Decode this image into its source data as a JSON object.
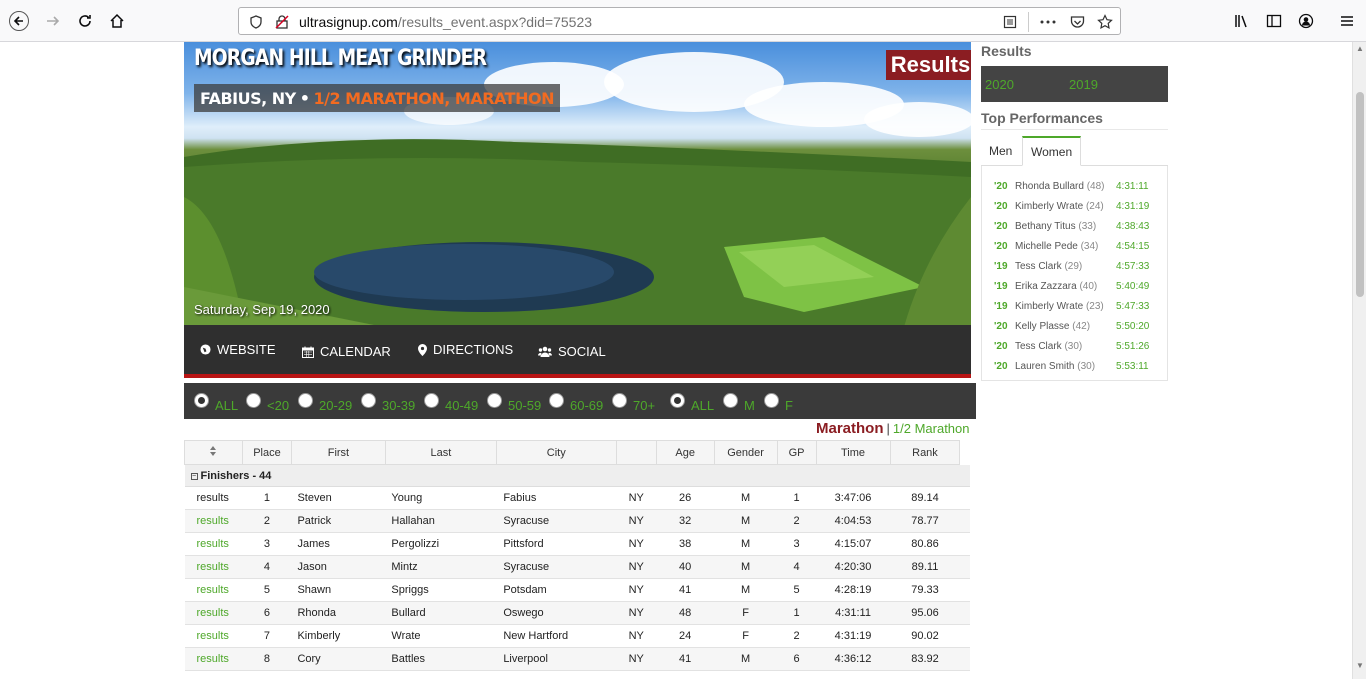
{
  "browser": {
    "url_domain": "ultrasignup.com",
    "url_path": "/results_event.aspx?did=75523"
  },
  "hero": {
    "title": "MORGAN HILL MEAT GRINDER",
    "location": "FABIUS, NY",
    "separator": "•",
    "distances": "1/2 MARATHON, MARATHON",
    "badge": "Results",
    "date": "Saturday, Sep 19, 2020"
  },
  "nav": {
    "website": "WEBSITE",
    "calendar": "CALENDAR",
    "directions": "DIRECTIONS",
    "social": "SOCIAL"
  },
  "filters": {
    "age": [
      {
        "label": "ALL",
        "selected": true
      },
      {
        "label": "<20",
        "selected": false
      },
      {
        "label": "20-29",
        "selected": false
      },
      {
        "label": "30-39",
        "selected": false
      },
      {
        "label": "40-49",
        "selected": false
      },
      {
        "label": "50-59",
        "selected": false
      },
      {
        "label": "60-69",
        "selected": false
      },
      {
        "label": "70+",
        "selected": false
      }
    ],
    "gender": [
      {
        "label": "ALL",
        "selected": true
      },
      {
        "label": "M",
        "selected": false
      },
      {
        "label": "F",
        "selected": false
      }
    ]
  },
  "distance_tabs": {
    "active": "Marathon",
    "separator": "|",
    "other": "1/2 Marathon"
  },
  "table": {
    "sort_icon": "sort-arrows-icon",
    "headers": [
      "Place",
      "First",
      "Last",
      "City",
      "",
      "Age",
      "Gender",
      "GP",
      "Time",
      "Rank"
    ],
    "group_label": "Finishers - 44",
    "rows": [
      {
        "link": "results",
        "place": "1",
        "first": "Steven",
        "last": "Young",
        "city": "Fabius",
        "state": "NY",
        "age": "26",
        "gender": "M",
        "gp": "1",
        "time": "3:47:06",
        "rank": "89.14"
      },
      {
        "link": "results",
        "place": "2",
        "first": "Patrick",
        "last": "Hallahan",
        "city": "Syracuse",
        "state": "NY",
        "age": "32",
        "gender": "M",
        "gp": "2",
        "time": "4:04:53",
        "rank": "78.77"
      },
      {
        "link": "results",
        "place": "3",
        "first": "James",
        "last": "Pergolizzi",
        "city": "Pittsford",
        "state": "NY",
        "age": "38",
        "gender": "M",
        "gp": "3",
        "time": "4:15:07",
        "rank": "80.86"
      },
      {
        "link": "results",
        "place": "4",
        "first": "Jason",
        "last": "Mintz",
        "city": "Syracuse",
        "state": "NY",
        "age": "40",
        "gender": "M",
        "gp": "4",
        "time": "4:20:30",
        "rank": "89.11"
      },
      {
        "link": "results",
        "place": "5",
        "first": "Shawn",
        "last": "Spriggs",
        "city": "Potsdam",
        "state": "NY",
        "age": "41",
        "gender": "M",
        "gp": "5",
        "time": "4:28:19",
        "rank": "79.33"
      },
      {
        "link": "results",
        "place": "6",
        "first": "Rhonda",
        "last": "Bullard",
        "city": "Oswego",
        "state": "NY",
        "age": "48",
        "gender": "F",
        "gp": "1",
        "time": "4:31:11",
        "rank": "95.06"
      },
      {
        "link": "results",
        "place": "7",
        "first": "Kimberly",
        "last": "Wrate",
        "city": "New Hartford",
        "state": "NY",
        "age": "24",
        "gender": "F",
        "gp": "2",
        "time": "4:31:19",
        "rank": "90.02"
      },
      {
        "link": "results",
        "place": "8",
        "first": "Cory",
        "last": "Battles",
        "city": "Liverpool",
        "state": "NY",
        "age": "41",
        "gender": "M",
        "gp": "6",
        "time": "4:36:12",
        "rank": "83.92"
      }
    ]
  },
  "sidebar": {
    "results_title": "Results",
    "years": [
      "2020",
      "2019"
    ],
    "top_title": "Top Performances",
    "tab_men": "Men",
    "tab_women": "Women",
    "performances": [
      {
        "year": "'20",
        "name": "Rhonda Bullard",
        "age": "(48)",
        "time": "4:31:11"
      },
      {
        "year": "'20",
        "name": "Kimberly Wrate",
        "age": "(24)",
        "time": "4:31:19"
      },
      {
        "year": "'20",
        "name": "Bethany Titus",
        "age": "(33)",
        "time": "4:38:43"
      },
      {
        "year": "'20",
        "name": "Michelle Pede",
        "age": "(34)",
        "time": "4:54:15"
      },
      {
        "year": "'19",
        "name": "Tess Clark",
        "age": "(29)",
        "time": "4:57:33"
      },
      {
        "year": "'19",
        "name": "Erika Zazzara",
        "age": "(40)",
        "time": "5:40:49"
      },
      {
        "year": "'19",
        "name": "Kimberly Wrate",
        "age": "(23)",
        "time": "5:47:33"
      },
      {
        "year": "'20",
        "name": "Kelly Plasse",
        "age": "(42)",
        "time": "5:50:20"
      },
      {
        "year": "'20",
        "name": "Tess Clark",
        "age": "(30)",
        "time": "5:51:26"
      },
      {
        "year": "'20",
        "name": "Lauren Smith",
        "age": "(30)",
        "time": "5:53:11"
      }
    ]
  },
  "colors": {
    "link_green": "#4ea82a",
    "brand_red": "#8b1d22",
    "nav_bg": "#2f2f2f"
  }
}
